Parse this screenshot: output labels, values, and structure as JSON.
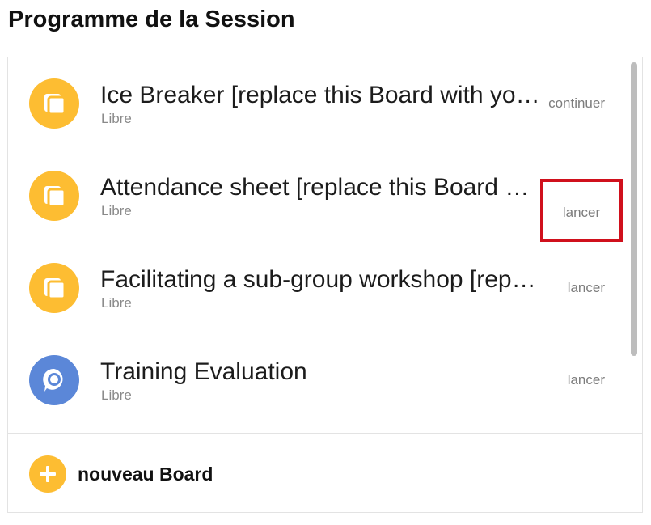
{
  "page": {
    "title": "Programme de la Session"
  },
  "boards": [
    {
      "name": "Ice Breaker [replace this Board with your own]",
      "status": "Libre",
      "action": "continuer",
      "icon": "folder-icon"
    },
    {
      "name": "Attendance sheet [replace this Board with your own]",
      "status": "Libre",
      "action": "lancer",
      "icon": "folder-icon"
    },
    {
      "name": "Facilitating a sub-group workshop [replace this Board]",
      "status": "Libre",
      "action": "lancer",
      "icon": "folder-icon"
    },
    {
      "name": "Training Evaluation",
      "status": "Libre",
      "action": "lancer",
      "icon": "chat-bubble-icon"
    }
  ],
  "footer": {
    "add_label": "nouveau Board"
  },
  "colors": {
    "folder_icon_bg": "#fdbd32",
    "chat_icon_bg": "#5b87d8",
    "highlight_border": "#d0101c"
  }
}
